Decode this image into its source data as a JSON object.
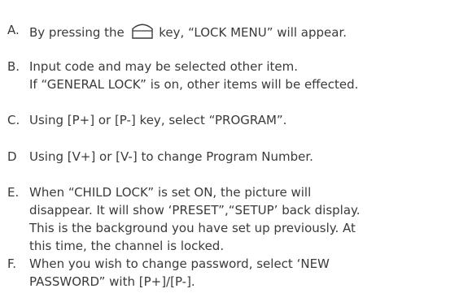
{
  "steps": [
    {
      "marker": "A.",
      "before_icon": "By pressing the ",
      "icon": "lock-menu-key-icon",
      "after_icon": " key, “LOCK MENU” will appear."
    },
    {
      "marker": "B.",
      "lines": [
        "Input code and may be selected other item.",
        "If “GENERAL LOCK” is on, other items will be effected."
      ]
    },
    {
      "marker": "C.",
      "lines": [
        "Using [P+] or [P-] key, select “PROGRAM”."
      ]
    },
    {
      "marker": "D",
      "lines": [
        "Using [V+] or [V-] to change Program Number."
      ]
    },
    {
      "marker": "E.",
      "lines": [
        "When “CHILD LOCK” is set ON, the picture will",
        "disappear. It will show ‘PRESET”,“SETUP’ back display.",
        "This is the background you have set up previously. At",
        "this time, the channel is locked."
      ]
    },
    {
      "marker": "F.",
      "lines": [
        "When you wish to change password, select ‘NEW",
        "PASSWORD” with [P+]/[P-]."
      ]
    }
  ]
}
